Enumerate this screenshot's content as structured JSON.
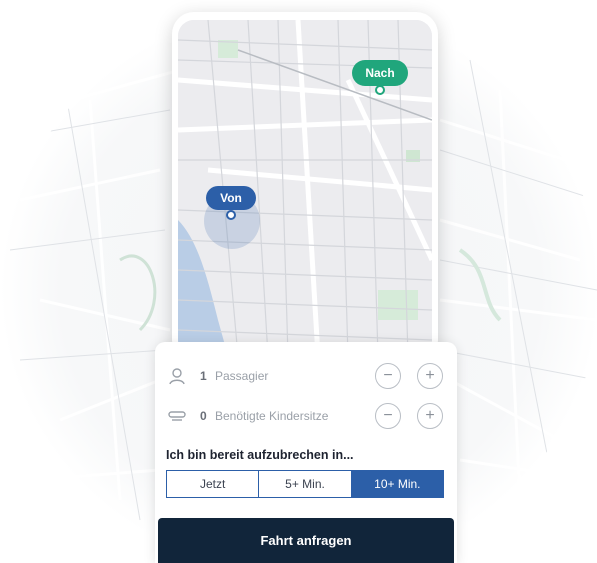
{
  "map": {
    "pin_to_label": "Nach",
    "pin_from_label": "Von"
  },
  "booking": {
    "passengers": {
      "count": "1",
      "label": "Passagier"
    },
    "child_seats": {
      "count": "0",
      "label": "Benötigte Kindersitze"
    },
    "minus_symbol": "−",
    "plus_symbol": "+",
    "ready_heading": "Ich bin bereit aufzubrechen in...",
    "departure_options": [
      "Jetzt",
      "5+ Min.",
      "10+ Min."
    ],
    "selected_option": "10+ Min.",
    "request_button": "Fahrt anfragen"
  },
  "colors": {
    "accent_blue": "#2c5fa8",
    "accent_green": "#20a67c",
    "cta_dark": "#11253a"
  },
  "icons": [
    "person-icon",
    "child-seat-icon",
    "minus-icon",
    "plus-icon",
    "location-pin-icon"
  ]
}
